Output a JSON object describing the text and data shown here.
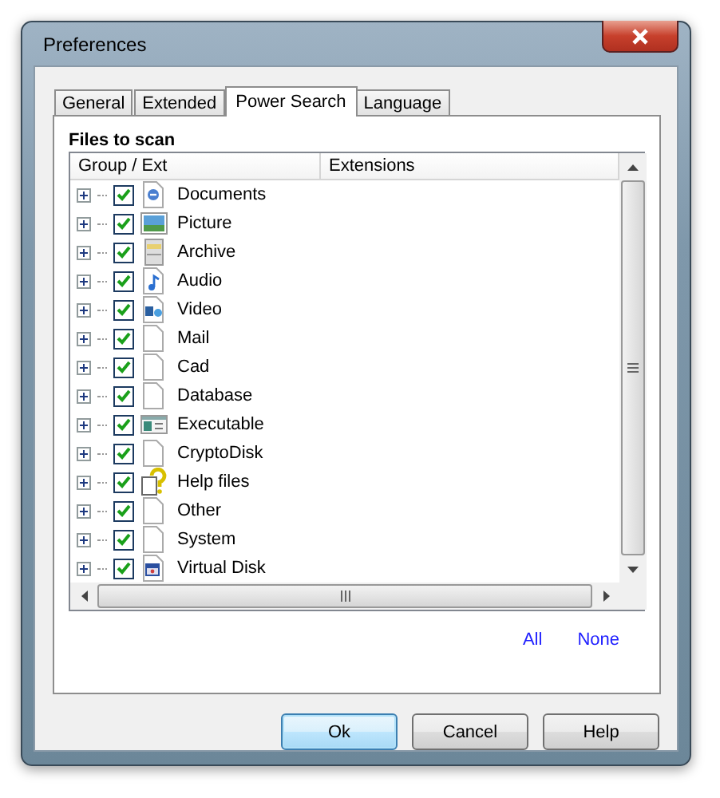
{
  "window": {
    "title": "Preferences"
  },
  "tabs": [
    {
      "label": "General",
      "selected": false
    },
    {
      "label": "Extended",
      "selected": false
    },
    {
      "label": "Power Search",
      "selected": true
    },
    {
      "label": "Language",
      "selected": false
    }
  ],
  "section_title": "Files to scan",
  "columns": [
    "Group / Ext",
    "Extensions"
  ],
  "rows": [
    {
      "name": "Documents",
      "kind": "document",
      "checked": true,
      "expanded": false
    },
    {
      "name": "Picture",
      "kind": "picture",
      "checked": true,
      "expanded": false
    },
    {
      "name": "Archive",
      "kind": "archive",
      "checked": true,
      "expanded": false
    },
    {
      "name": "Audio",
      "kind": "audio",
      "checked": true,
      "expanded": false
    },
    {
      "name": "Video",
      "kind": "video",
      "checked": true,
      "expanded": false
    },
    {
      "name": "Mail",
      "kind": "blank",
      "checked": true,
      "expanded": false
    },
    {
      "name": "Cad",
      "kind": "blank",
      "checked": true,
      "expanded": false
    },
    {
      "name": "Database",
      "kind": "blank",
      "checked": true,
      "expanded": false
    },
    {
      "name": "Executable",
      "kind": "executable",
      "checked": true,
      "expanded": false
    },
    {
      "name": "CryptoDisk",
      "kind": "blank",
      "checked": true,
      "expanded": false
    },
    {
      "name": "Help files",
      "kind": "help",
      "checked": true,
      "expanded": false
    },
    {
      "name": "Other",
      "kind": "blank",
      "checked": true,
      "expanded": false
    },
    {
      "name": "System",
      "kind": "blank",
      "checked": true,
      "expanded": false
    },
    {
      "name": "Virtual Disk",
      "kind": "disk",
      "checked": true,
      "expanded": false
    }
  ],
  "links": [
    "All",
    "None"
  ],
  "buttons": [
    {
      "label": "Ok",
      "default": true
    },
    {
      "label": "Cancel",
      "default": false
    },
    {
      "label": "Help",
      "default": false
    }
  ]
}
